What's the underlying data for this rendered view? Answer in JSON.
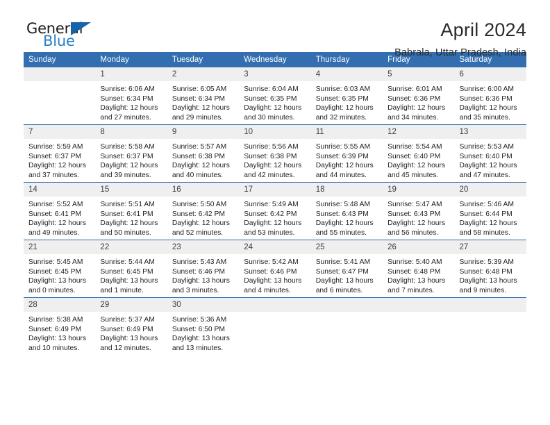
{
  "brand": {
    "name_part1": "General",
    "name_part2": "Blue",
    "logo_icon": "triangle-logo-icon",
    "accent_color": "#1565a8",
    "text_color": "#2a7fc9"
  },
  "header": {
    "title": "April 2024",
    "subtitle": "Babrala, Uttar Pradesh, India"
  },
  "theme": {
    "header_row_bg": "#336fb0",
    "daynum_bg": "#efefef",
    "row_divider": "#2d6ca8",
    "cell_bg": "#ffffff",
    "body_text": "#1f1f1f"
  },
  "columns": [
    "Sunday",
    "Monday",
    "Tuesday",
    "Wednesday",
    "Thursday",
    "Friday",
    "Saturday"
  ],
  "weeks": [
    [
      {
        "day": "",
        "lines": []
      },
      {
        "day": "1",
        "lines": [
          "Sunrise: 6:06 AM",
          "Sunset: 6:34 PM",
          "Daylight: 12 hours",
          "and 27 minutes."
        ]
      },
      {
        "day": "2",
        "lines": [
          "Sunrise: 6:05 AM",
          "Sunset: 6:34 PM",
          "Daylight: 12 hours",
          "and 29 minutes."
        ]
      },
      {
        "day": "3",
        "lines": [
          "Sunrise: 6:04 AM",
          "Sunset: 6:35 PM",
          "Daylight: 12 hours",
          "and 30 minutes."
        ]
      },
      {
        "day": "4",
        "lines": [
          "Sunrise: 6:03 AM",
          "Sunset: 6:35 PM",
          "Daylight: 12 hours",
          "and 32 minutes."
        ]
      },
      {
        "day": "5",
        "lines": [
          "Sunrise: 6:01 AM",
          "Sunset: 6:36 PM",
          "Daylight: 12 hours",
          "and 34 minutes."
        ]
      },
      {
        "day": "6",
        "lines": [
          "Sunrise: 6:00 AM",
          "Sunset: 6:36 PM",
          "Daylight: 12 hours",
          "and 35 minutes."
        ]
      }
    ],
    [
      {
        "day": "7",
        "lines": [
          "Sunrise: 5:59 AM",
          "Sunset: 6:37 PM",
          "Daylight: 12 hours",
          "and 37 minutes."
        ]
      },
      {
        "day": "8",
        "lines": [
          "Sunrise: 5:58 AM",
          "Sunset: 6:37 PM",
          "Daylight: 12 hours",
          "and 39 minutes."
        ]
      },
      {
        "day": "9",
        "lines": [
          "Sunrise: 5:57 AM",
          "Sunset: 6:38 PM",
          "Daylight: 12 hours",
          "and 40 minutes."
        ]
      },
      {
        "day": "10",
        "lines": [
          "Sunrise: 5:56 AM",
          "Sunset: 6:38 PM",
          "Daylight: 12 hours",
          "and 42 minutes."
        ]
      },
      {
        "day": "11",
        "lines": [
          "Sunrise: 5:55 AM",
          "Sunset: 6:39 PM",
          "Daylight: 12 hours",
          "and 44 minutes."
        ]
      },
      {
        "day": "12",
        "lines": [
          "Sunrise: 5:54 AM",
          "Sunset: 6:40 PM",
          "Daylight: 12 hours",
          "and 45 minutes."
        ]
      },
      {
        "day": "13",
        "lines": [
          "Sunrise: 5:53 AM",
          "Sunset: 6:40 PM",
          "Daylight: 12 hours",
          "and 47 minutes."
        ]
      }
    ],
    [
      {
        "day": "14",
        "lines": [
          "Sunrise: 5:52 AM",
          "Sunset: 6:41 PM",
          "Daylight: 12 hours",
          "and 49 minutes."
        ]
      },
      {
        "day": "15",
        "lines": [
          "Sunrise: 5:51 AM",
          "Sunset: 6:41 PM",
          "Daylight: 12 hours",
          "and 50 minutes."
        ]
      },
      {
        "day": "16",
        "lines": [
          "Sunrise: 5:50 AM",
          "Sunset: 6:42 PM",
          "Daylight: 12 hours",
          "and 52 minutes."
        ]
      },
      {
        "day": "17",
        "lines": [
          "Sunrise: 5:49 AM",
          "Sunset: 6:42 PM",
          "Daylight: 12 hours",
          "and 53 minutes."
        ]
      },
      {
        "day": "18",
        "lines": [
          "Sunrise: 5:48 AM",
          "Sunset: 6:43 PM",
          "Daylight: 12 hours",
          "and 55 minutes."
        ]
      },
      {
        "day": "19",
        "lines": [
          "Sunrise: 5:47 AM",
          "Sunset: 6:43 PM",
          "Daylight: 12 hours",
          "and 56 minutes."
        ]
      },
      {
        "day": "20",
        "lines": [
          "Sunrise: 5:46 AM",
          "Sunset: 6:44 PM",
          "Daylight: 12 hours",
          "and 58 minutes."
        ]
      }
    ],
    [
      {
        "day": "21",
        "lines": [
          "Sunrise: 5:45 AM",
          "Sunset: 6:45 PM",
          "Daylight: 13 hours",
          "and 0 minutes."
        ]
      },
      {
        "day": "22",
        "lines": [
          "Sunrise: 5:44 AM",
          "Sunset: 6:45 PM",
          "Daylight: 13 hours",
          "and 1 minute."
        ]
      },
      {
        "day": "23",
        "lines": [
          "Sunrise: 5:43 AM",
          "Sunset: 6:46 PM",
          "Daylight: 13 hours",
          "and 3 minutes."
        ]
      },
      {
        "day": "24",
        "lines": [
          "Sunrise: 5:42 AM",
          "Sunset: 6:46 PM",
          "Daylight: 13 hours",
          "and 4 minutes."
        ]
      },
      {
        "day": "25",
        "lines": [
          "Sunrise: 5:41 AM",
          "Sunset: 6:47 PM",
          "Daylight: 13 hours",
          "and 6 minutes."
        ]
      },
      {
        "day": "26",
        "lines": [
          "Sunrise: 5:40 AM",
          "Sunset: 6:48 PM",
          "Daylight: 13 hours",
          "and 7 minutes."
        ]
      },
      {
        "day": "27",
        "lines": [
          "Sunrise: 5:39 AM",
          "Sunset: 6:48 PM",
          "Daylight: 13 hours",
          "and 9 minutes."
        ]
      }
    ],
    [
      {
        "day": "28",
        "lines": [
          "Sunrise: 5:38 AM",
          "Sunset: 6:49 PM",
          "Daylight: 13 hours",
          "and 10 minutes."
        ]
      },
      {
        "day": "29",
        "lines": [
          "Sunrise: 5:37 AM",
          "Sunset: 6:49 PM",
          "Daylight: 13 hours",
          "and 12 minutes."
        ]
      },
      {
        "day": "30",
        "lines": [
          "Sunrise: 5:36 AM",
          "Sunset: 6:50 PM",
          "Daylight: 13 hours",
          "and 13 minutes."
        ]
      },
      {
        "day": "",
        "lines": []
      },
      {
        "day": "",
        "lines": []
      },
      {
        "day": "",
        "lines": []
      },
      {
        "day": "",
        "lines": []
      }
    ]
  ]
}
